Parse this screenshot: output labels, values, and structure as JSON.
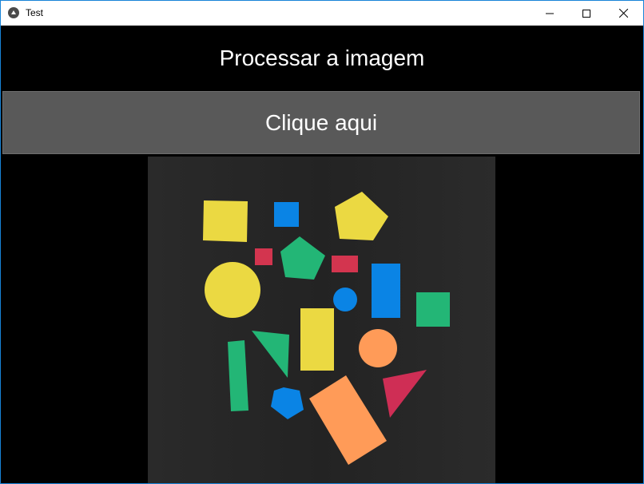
{
  "window": {
    "title": "Test",
    "icons": {
      "app": "kivy-logo-icon",
      "minimize": "minimize-icon",
      "maximize": "maximize-icon",
      "close": "close-icon"
    }
  },
  "header": {
    "label": "Processar a imagem"
  },
  "action": {
    "button_label": "Clique aqui"
  },
  "image": {
    "description_name": "colored-shapes-photo",
    "background_color": "#262626",
    "shape_colors": {
      "yellow": "#e9d63f",
      "blue": "#0a82e4",
      "green": "#22b574",
      "red": "#d2334f",
      "orange": "#ff9a57",
      "pink_red": "#cf2e55"
    }
  },
  "colors": {
    "button_bg": "#595959",
    "window_border": "#1883d7"
  }
}
